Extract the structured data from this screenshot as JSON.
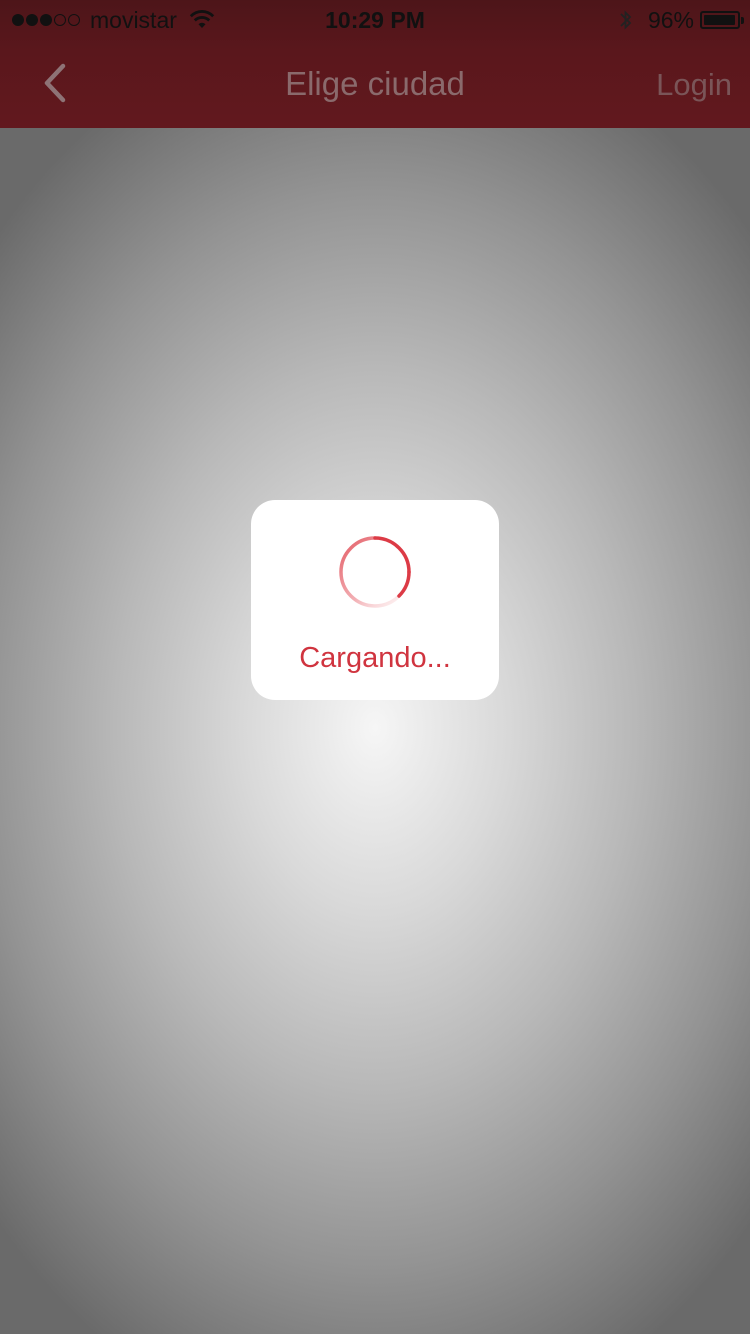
{
  "status_bar": {
    "carrier": "movistar",
    "time": "10:29 PM",
    "battery_percent": "96%",
    "battery_level": 0.96,
    "signal_strength": 3,
    "signal_max": 5
  },
  "nav": {
    "title": "Elige ciudad",
    "login_label": "Login"
  },
  "loading": {
    "text": "Cargando..."
  },
  "colors": {
    "nav_background": "#5e171d",
    "accent": "#d0343f",
    "hud_background": "#ffffff"
  },
  "icons": {
    "back": "chevron-left-icon",
    "wifi": "wifi-icon",
    "bluetooth": "bluetooth-icon",
    "battery": "battery-icon",
    "spinner": "spinner-icon"
  }
}
